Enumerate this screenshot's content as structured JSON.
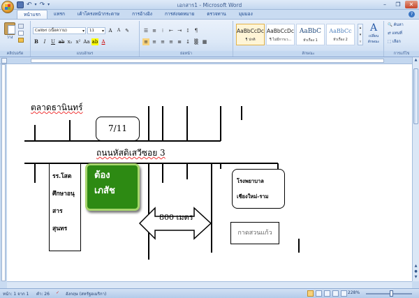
{
  "window": {
    "title": "เอกสาร1 - Microsoft Word"
  },
  "tabs": [
    {
      "label": "หน้าแรก",
      "active": true
    },
    {
      "label": "แทรก"
    },
    {
      "label": "เค้าโครงหน้ากระดาษ"
    },
    {
      "label": "การอ้างอิง"
    },
    {
      "label": "การส่งจดหมาย"
    },
    {
      "label": "ตรวจทาน"
    },
    {
      "label": "มุมมอง"
    }
  ],
  "ribbon": {
    "clipboard": {
      "paste_label": "วาง",
      "group_label": "คลิปบอร์ด"
    },
    "font": {
      "font_name": "Calibri (เนื้อความ)",
      "font_size": "11",
      "group_label": "แบบอักษร"
    },
    "paragraph": {
      "group_label": "ย่อหน้า"
    },
    "styles": {
      "group_label": "ลักษณะ",
      "items": [
        {
          "sample": "AaBbCcDc",
          "name": "¶ ปกติ",
          "active": true
        },
        {
          "sample": "AaBbCcDc",
          "name": "¶ ไม่มีการเว..."
        },
        {
          "sample": "AaBbC",
          "name": "หัวเรื่อง 1"
        },
        {
          "sample": "AaBbCc",
          "name": "หัวเรื่อง 2"
        }
      ],
      "change_label": "เปลี่ยน ลักษณะ"
    },
    "editing": {
      "group_label": "การแก้ไข",
      "find": "ค้นหา",
      "replace": "แทนที่",
      "select": "เลือก"
    }
  },
  "document": {
    "market_label": "ตลาดธานินทร์",
    "box_711": "7/11",
    "road_label": "ถนนหัสดิเสวีซอย 3",
    "school": [
      "รร.โสต",
      "ศึกษาอนุ",
      "สาร",
      "สุนทร"
    ],
    "pharmacy": [
      "ต้อง",
      "เภสัช"
    ],
    "distance": "800 เมตร",
    "hospital": [
      "โรงพยาบาล",
      "เชียงใหม่-ราม"
    ],
    "kad": "กาดสวนแก้ว"
  },
  "status": {
    "page": "หน้า: 1 จาก 1",
    "words": "คำ: 26",
    "language": "อังกฤษ (สหรัฐอเมริกา)",
    "zoom": "228%"
  },
  "colors": {
    "pharmacy_fill": "#2d8a13",
    "pharmacy_border": "#a6d56c"
  }
}
